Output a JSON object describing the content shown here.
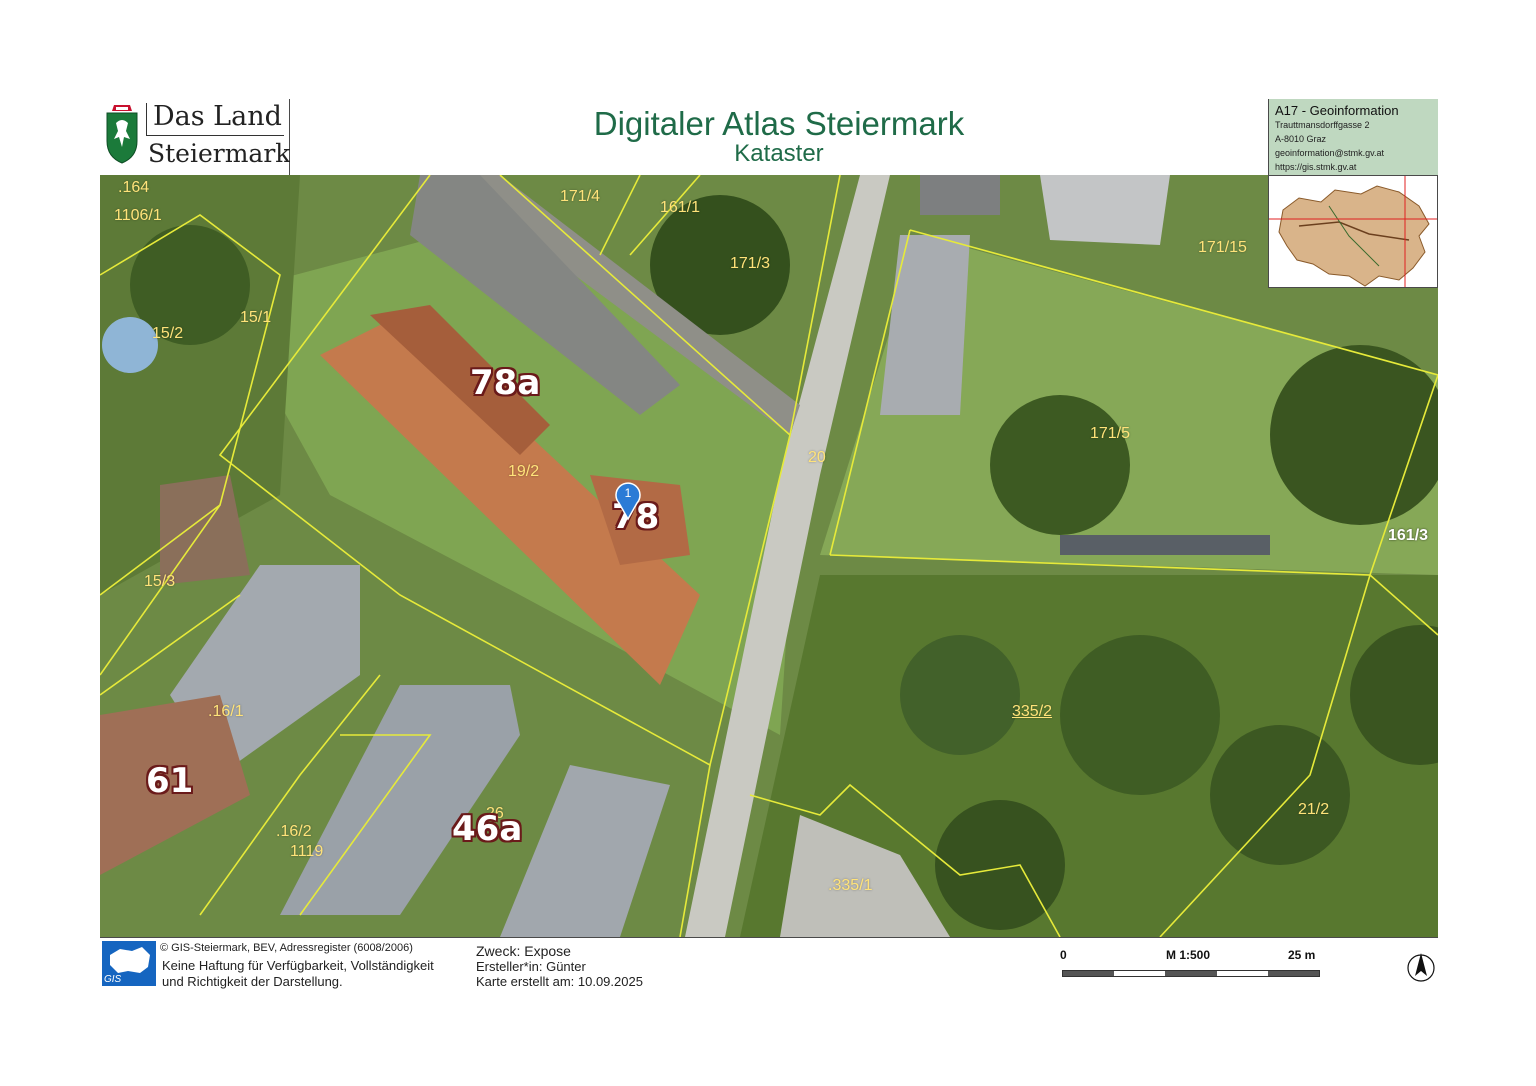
{
  "header": {
    "logo_line1": "Das Land",
    "logo_line2": "Steiermark",
    "title": "Digitaler Atlas Steiermark",
    "subtitle": "Kataster"
  },
  "info": {
    "title": "A17 - Geoinformation",
    "address": "Trauttmansdorffgasse 2",
    "city": "A-8010 Graz",
    "email": "geoinformation@stmk.gv.at",
    "url": "https://gis.stmk.gv.at"
  },
  "map": {
    "parcels": [
      {
        "id": "p164",
        "label": ".164"
      },
      {
        "id": "p1106",
        "label": "1106/1"
      },
      {
        "id": "p1714",
        "label": "171/4"
      },
      {
        "id": "p1611",
        "label": "161/1"
      },
      {
        "id": "p1713",
        "label": "171/3"
      },
      {
        "id": "p17115",
        "label": "171/15"
      },
      {
        "id": "p152",
        "label": "15/2"
      },
      {
        "id": "p151",
        "label": "15/1"
      },
      {
        "id": "p192",
        "label": "19/2"
      },
      {
        "id": "p20",
        "label": "20"
      },
      {
        "id": "p1715",
        "label": "171/5"
      },
      {
        "id": "p1613",
        "label": "161/3"
      },
      {
        "id": "p153",
        "label": "15/3"
      },
      {
        "id": "p3352",
        "label": "335/2"
      },
      {
        "id": "p161",
        "label": ".16/1"
      },
      {
        "id": "p212",
        "label": "21/2"
      },
      {
        "id": "p26",
        "label": "26"
      },
      {
        "id": "p162",
        "label": ".16/2"
      },
      {
        "id": "p1119",
        "label": "1119"
      },
      {
        "id": "p3351",
        "label": ".335/1"
      }
    ],
    "house_numbers": [
      {
        "id": "h78a",
        "label": "78a"
      },
      {
        "id": "h78",
        "label": "78"
      },
      {
        "id": "h61",
        "label": "61"
      },
      {
        "id": "h46a",
        "label": "46a"
      }
    ],
    "marker_label": "1",
    "parcel_line_color": "#e6ea3a"
  },
  "footer": {
    "gis_logo_text": "GIS",
    "copyright": "© GIS-Steiermark, BEV, Adressregister (6008/2006)",
    "disclaimer_line1": "Keine Haftung für Verfügbarkeit, Vollständigkeit",
    "disclaimer_line2": "und Richtigkeit der Darstellung.",
    "purpose": "Zweck: Expose",
    "creator": "Ersteller*in: Günter",
    "created": "Karte erstellt am: 10.09.2025",
    "scale_start": "0",
    "scale_ratio": "M 1:500",
    "scale_end": "25 m"
  }
}
